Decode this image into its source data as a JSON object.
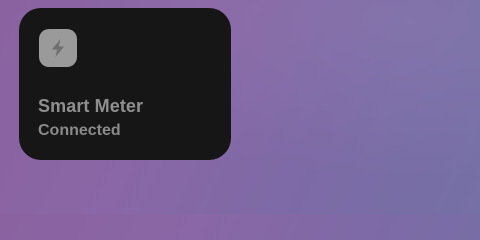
{
  "widget": {
    "title": "Smart Meter",
    "status": "Connected",
    "icon": "lightning-bolt-icon"
  },
  "colors": {
    "widget_background": "#161616",
    "icon_background": "#9a9a9a",
    "icon_glyph": "#6f6f6f",
    "text": "#8f8f8f",
    "wallpaper": "#8566a4"
  }
}
